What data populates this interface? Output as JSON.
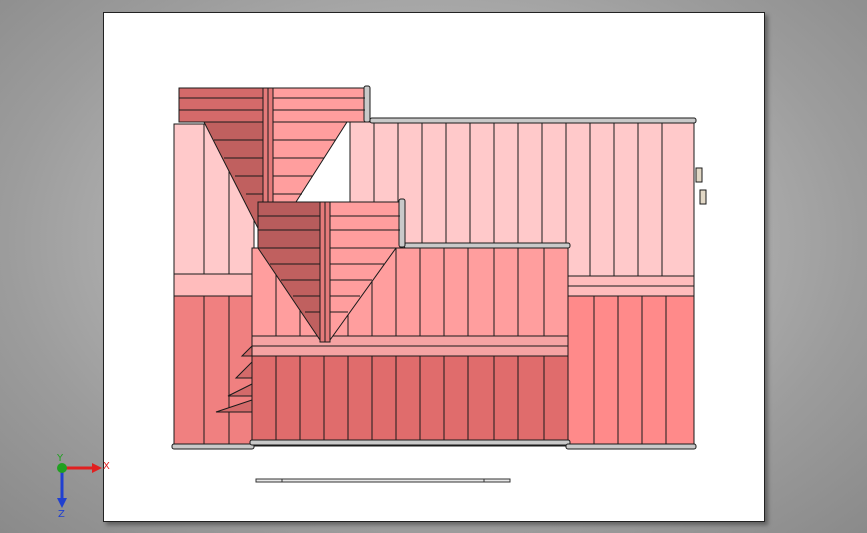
{
  "viewport": {
    "background_top": "#d3d3d3",
    "background_edge": "#8a8a8a"
  },
  "model": {
    "colors": {
      "light_panel": "#ffc9ca",
      "mid_panel": "#ff9e9e",
      "dark_panel": "#f07c7c",
      "deep_panel": "#d46a6a",
      "shade_panel": "#b85c5c",
      "outline": "#1a1a1a",
      "rail": "#c9c9c9",
      "knob": "#e2d8c6"
    }
  },
  "triad": {
    "x_label": "X",
    "y_label": "Y",
    "z_label": "Z",
    "x_color": "#e02020",
    "y_color": "#20a020",
    "z_color": "#2040d0"
  }
}
